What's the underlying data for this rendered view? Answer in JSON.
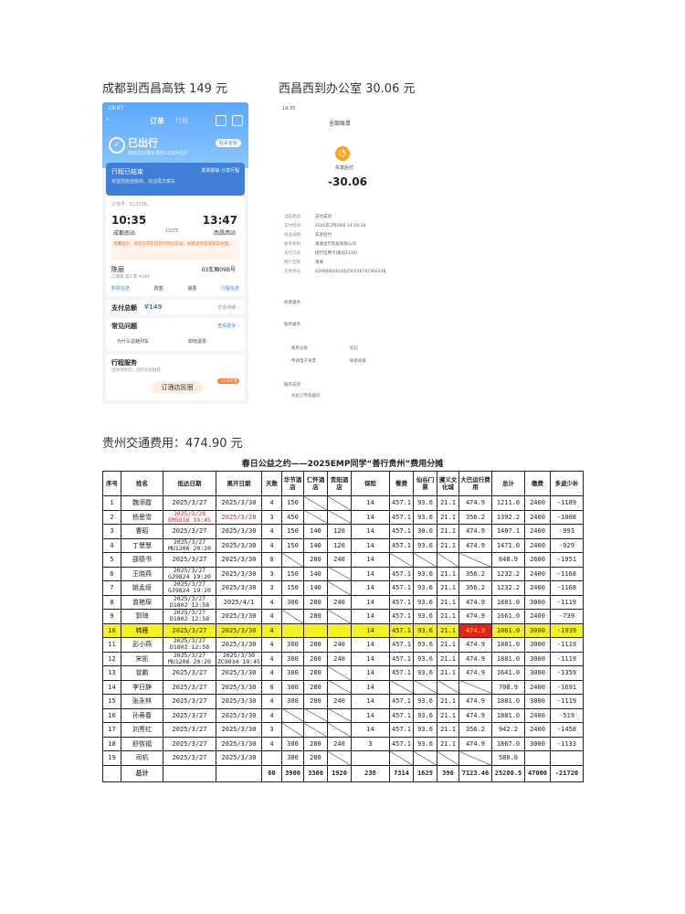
{
  "captions": {
    "train": "成都到西昌高铁 149 元",
    "taxi": "西昌西到办公室 30.06 元",
    "guizhou": "贵州交通费用：474.90 元"
  },
  "phone": {
    "status_time": "19:07",
    "tab_order": "订单",
    "tab_other": "行程",
    "out_title": "已出行",
    "out_sub": "感谢您的乘车使用12306出行",
    "service_btn": "联系客服",
    "band_title": "行程已结束",
    "band_sub": "希望您旅途愉快，欢迎再次乘车",
    "band_right": "发票报销  分享行程",
    "order_no": "订单号：E12736...",
    "depart_time": "10:35",
    "arrive_time": "13:47",
    "from_station": "成都南站",
    "to_station": "西昌西站",
    "train_no": "D275",
    "warn": "温馨提示：请您在开车前及时到达车站，如需退改签请提前办理。",
    "passenger": "陈丽",
    "seat": "03车厢09B号",
    "passenger_sub": "二等座 成人票 ¥149",
    "acts": [
      "购票信息",
      "改签",
      "退票",
      "行程信息"
    ],
    "pay_label": "支付总额",
    "pay_value": "¥149",
    "pay_right": "查看明细 ›",
    "faq_title": "常见问题",
    "faq_right": "查看更多 ›",
    "faq_q1": "为什么这趟列车",
    "faq_q2": "如何退票",
    "svc_title": "行程服务",
    "svc_sub": "出发地附近，酒店住宿推荐",
    "svc_btn": "订酒店民宿",
    "svc_hot": "入住享优惠"
  },
  "payment": {
    "status_time": "19:35",
    "header": "全部账单",
    "merchant_short": "先享后付",
    "amount": "-30.06",
    "rows": [
      {
        "k": "当前状态",
        "v": "支付成功"
      },
      {
        "k": "支付时间",
        "v": "2025年3月19日 14:16:18"
      },
      {
        "k": "商品说明",
        "v": "先享后付"
      },
      {
        "k": "收单机构",
        "v": "滴滴出行科技有限公司"
      },
      {
        "k": "支付方式",
        "v": "招行信用卡(尾号1234)"
      },
      {
        "k": "商户全称",
        "v": "滴滴"
      },
      {
        "k": "交易单号",
        "v": "420000026120250319747362316"
      }
    ],
    "links": [
      "账单分类",
      "标记",
      "申请电子发票",
      "联系商家",
      "对此订单有疑问",
      "投诉"
    ],
    "section1": "商家服务",
    "section2": "账单服务",
    "section3": "服务支持"
  },
  "table": {
    "title": "春日公益之约——2025EMP同学“善行贵州”费用分摊",
    "headers": [
      "序号",
      "姓名",
      "抵达日期",
      "离开日期",
      "天数",
      "华节酒店",
      "仁怀酒店",
      "贵阳酒店",
      "保险",
      "餐费",
      "仙谷门票",
      "遵义文化城",
      "大巴运行费用",
      "总计",
      "缴费",
      "多退少补"
    ],
    "rows": [
      {
        "no": "1",
        "name": "魏添霞",
        "arrive": "2025/3/27",
        "leave": "2025/3/30",
        "days": "4",
        "h1": "150",
        "h2": "",
        "h3": "",
        "ins": "14",
        "meal": "457.1",
        "ticket": "93.6",
        "culture": "21.1",
        "bus": "474.9",
        "total": "1211.0",
        "paid": "2400",
        "diff": "-1189"
      },
      {
        "no": "2",
        "name": "杨思雪",
        "arrive": "2025/3/28 EM5818 19:45",
        "leave": "2025/3/28",
        "days": "3",
        "h1": "450",
        "h2": "",
        "h3": "",
        "ins": "14",
        "meal": "457.1",
        "ticket": "93.6",
        "culture": "21.1",
        "bus": "356.2",
        "total": "1392.2",
        "paid": "2400",
        "diff": "-1008"
      },
      {
        "no": "3",
        "name": "曹昭",
        "arrive": "2025/3/27",
        "leave": "2025/3/30",
        "days": "4",
        "h1": "150",
        "h2": "140",
        "h3": "120",
        "ins": "14",
        "meal": "457.1",
        "ticket": "30.0",
        "culture": "21.1",
        "bus": "474.9",
        "total": "1407.1",
        "paid": "2400",
        "diff": "-993"
      },
      {
        "no": "4",
        "name": "丁慧慧",
        "arrive": "2025/3/27 MU1206 20:20",
        "leave": "2025/3/30",
        "days": "4",
        "h1": "150",
        "h2": "140",
        "h3": "120",
        "ins": "14",
        "meal": "457.1",
        "ticket": "93.6",
        "culture": "21.1",
        "bus": "474.9",
        "total": "1471.0",
        "paid": "2400",
        "diff": "-929"
      },
      {
        "no": "5",
        "name": "邵德书",
        "arrive": "2025/3/27",
        "leave": "2025/3/30",
        "days": "0",
        "h1": "",
        "h2": "280",
        "h3": "240",
        "ins": "14",
        "meal": "",
        "ticket": "",
        "culture": "",
        "bus": "",
        "total": "648.9",
        "paid": "2600",
        "diff": "-1951"
      },
      {
        "no": "6",
        "name": "王晓燕",
        "arrive": "2025/3/27 GJ9824 19:20",
        "leave": "2025/3/30",
        "days": "3",
        "h1": "150",
        "h2": "140",
        "h3": "",
        "ins": "14",
        "meal": "457.1",
        "ticket": "93.6",
        "culture": "21.1",
        "bus": "356.2",
        "total": "1232.2",
        "paid": "2400",
        "diff": "-1168"
      },
      {
        "no": "7",
        "name": "姚孟绥",
        "arrive": "2025/3/27 GJ9824 19:20",
        "leave": "2025/3/30",
        "days": "3",
        "h1": "150",
        "h2": "140",
        "h3": "",
        "ins": "14",
        "meal": "457.1",
        "ticket": "93.6",
        "culture": "21.1",
        "bus": "356.2",
        "total": "1232.2",
        "paid": "2400",
        "diff": "-1168"
      },
      {
        "no": "8",
        "name": "曾艳琛",
        "arrive": "2025/3/27 D1802 12:58",
        "leave": "2025/4/1",
        "days": "4",
        "h1": "300",
        "h2": "280",
        "h3": "240",
        "ins": "14",
        "meal": "457.1",
        "ticket": "93.6",
        "culture": "21.1",
        "bus": "474.9",
        "total": "1881.0",
        "paid": "3000",
        "diff": "-1119"
      },
      {
        "no": "9",
        "name": "郭琦",
        "arrive": "2025/3/27 D1802 12:58",
        "leave": "2025/3/30",
        "days": "4",
        "h1": "",
        "h2": "280",
        "h3": "",
        "ins": "14",
        "meal": "457.1",
        "ticket": "93.6",
        "culture": "21.1",
        "bus": "474.9",
        "total": "1661.0",
        "paid": "2400",
        "diff": "-739"
      },
      {
        "no": "10",
        "name": "韩雁",
        "arrive": "2025/3/27",
        "leave": "2025/3/30",
        "days": "4",
        "h1": "",
        "h2": "",
        "h3": "",
        "ins": "14",
        "meal": "457.1",
        "ticket": "93.6",
        "culture": "21.1",
        "bus": "474.9",
        "total": "1061.0",
        "paid": "3000",
        "diff": "-1939"
      },
      {
        "no": "11",
        "name": "彭小燕",
        "arrive": "2025/3/27 D1802 12:58",
        "leave": "2025/3/30",
        "days": "4",
        "h1": "300",
        "h2": "280",
        "h3": "240",
        "ins": "14",
        "meal": "457.1",
        "ticket": "93.6",
        "culture": "21.1",
        "bus": "474.9",
        "total": "1881.0",
        "paid": "3000",
        "diff": "-1119"
      },
      {
        "no": "12",
        "name": "宋凯",
        "arrive": "2025/3/27 MU1206 20:20",
        "leave": "2025/3/30 ZC9034 19:45",
        "days": "4",
        "h1": "300",
        "h2": "280",
        "h3": "240",
        "ins": "14",
        "meal": "457.1",
        "ticket": "93.6",
        "culture": "21.1",
        "bus": "474.9",
        "total": "1881.0",
        "paid": "3000",
        "diff": "-1119"
      },
      {
        "no": "13",
        "name": "曾鹏",
        "arrive": "2025/3/27",
        "leave": "2025/3/30",
        "days": "4",
        "h1": "300",
        "h2": "280",
        "h3": "",
        "ins": "14",
        "meal": "457.1",
        "ticket": "93.6",
        "culture": "21.1",
        "bus": "474.9",
        "total": "1641.0",
        "paid": "3000",
        "diff": "-1359"
      },
      {
        "no": "14",
        "name": "李日静",
        "arrive": "2025/3/27",
        "leave": "2025/3/30",
        "days": "0",
        "h1": "300",
        "h2": "280",
        "h3": "",
        "ins": "14",
        "meal": "",
        "ticket": "",
        "culture": "",
        "bus": "",
        "total": "708.9",
        "paid": "2400",
        "diff": "-1691"
      },
      {
        "no": "15",
        "name": "张永林",
        "arrive": "2025/3/27",
        "leave": "2025/3/30",
        "days": "4",
        "h1": "300",
        "h2": "280",
        "h3": "240",
        "ins": "14",
        "meal": "457.1",
        "ticket": "93.6",
        "culture": "21.1",
        "bus": "474.9",
        "total": "1881.0",
        "paid": "3000",
        "diff": "-1119"
      },
      {
        "no": "16",
        "name": "孙寿春",
        "arrive": "2025/3/27",
        "leave": "2025/3/30",
        "days": "4",
        "h1": "",
        "h2": "",
        "h3": "",
        "ins": "14",
        "meal": "457.1",
        "ticket": "93.6",
        "culture": "21.1",
        "bus": "474.9",
        "total": "1881.0",
        "paid": "2400",
        "diff": "-519"
      },
      {
        "no": "17",
        "name": "刘秀红",
        "arrive": "2025/3/27",
        "leave": "2025/3/30",
        "days": "3",
        "h1": "",
        "h2": "",
        "h3": "",
        "ins": "14",
        "meal": "457.1",
        "ticket": "93.6",
        "culture": "21.1",
        "bus": "356.2",
        "total": "942.2",
        "paid": "2400",
        "diff": "-1458"
      },
      {
        "no": "18",
        "name": "舒恢福",
        "arrive": "2025/3/27",
        "leave": "2025/3/30",
        "days": "4",
        "h1": "300",
        "h2": "280",
        "h3": "240",
        "ins": "3",
        "meal": "457.1",
        "ticket": "93.6",
        "culture": "21.1",
        "bus": "474.9",
        "total": "1867.0",
        "paid": "3000",
        "diff": "-1133"
      },
      {
        "no": "19",
        "name": "司机",
        "arrive": "2025/3/27",
        "leave": "2025/3/30",
        "days": "",
        "h1": "300",
        "h2": "280",
        "h3": "",
        "ins": "",
        "meal": "",
        "ticket": "",
        "culture": "",
        "bus": "",
        "total": "580.0",
        "paid": "",
        "diff": ""
      }
    ],
    "total_row": {
      "label": "总计",
      "days": "60",
      "h1": "3900",
      "h2": "3360",
      "h3": "1920",
      "ins": "238",
      "meal": "7314",
      "ticket": "1625",
      "culture": "396",
      "bus": "7123.46",
      "total": "25280.5",
      "paid": "47000",
      "diff": "-21720"
    },
    "highlight_row": "10",
    "colors": {
      "highlight": "#f6f01e",
      "alert": "#e8201c",
      "red_text": "#d8262b"
    }
  }
}
